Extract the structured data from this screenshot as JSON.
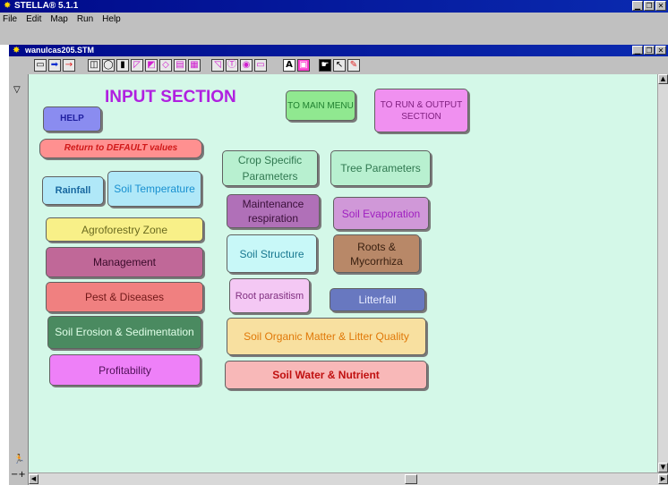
{
  "app": {
    "title": "STELLA® 5.1.1"
  },
  "menu": [
    "File",
    "Edit",
    "Map",
    "Run",
    "Help"
  ],
  "document": {
    "title": "wanulcas205.STM"
  },
  "canvas": {
    "heading": "INPUT SECTION",
    "buttons": {
      "help": "HELP",
      "to_main_menu": "TO MAIN MENU",
      "to_run_output": "TO RUN & OUTPUT SECTION",
      "return_default": "Return to DEFAULT values",
      "rainfall": "Rainfall",
      "soil_temperature": "Soil Temperature",
      "agroforestry_zone": "Agroforestry Zone",
      "management": "Management",
      "pest_diseases": "Pest & Diseases",
      "soil_erosion": "Soil Erosion & Sedimentation",
      "profitability": "Profitability",
      "crop_specific": "Crop Specific Parameters",
      "tree_parameters": "Tree Parameters",
      "maintenance_respiration": "Maintenance respiration",
      "soil_evaporation": "Soil Evaporation",
      "soil_structure": "Soil Structure",
      "roots_mycorrhiza": "Roots & Mycorrhiza",
      "root_parasitism": "Root parasitism",
      "litterfall": "Litterfall",
      "soil_organic_matter": "Soil Organic Matter & Litter Quality",
      "soil_water_nutrient": "Soil Water & Nutrient"
    }
  },
  "toolbar_glyph": "A"
}
